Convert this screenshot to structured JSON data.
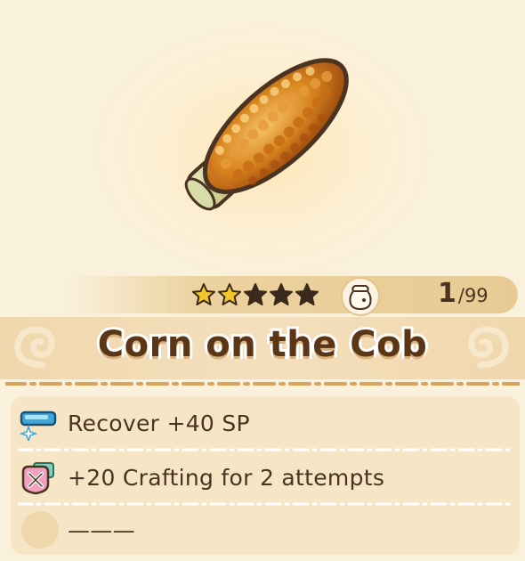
{
  "item": {
    "name": "Corn on the Cob",
    "icon": "corn-cob-icon",
    "rating_filled": 2,
    "rating_total": 5,
    "quantity": "1",
    "quantity_max": "/99"
  },
  "effects": [
    {
      "icon": "sp-bar-icon",
      "text": "Recover +40 SP"
    },
    {
      "icon": "crafting-tools-icon",
      "text": "+20 Crafting for 2 attempts"
    },
    {
      "icon": "empty-slot",
      "text": "———"
    }
  ],
  "colors": {
    "background": "#faf1dc",
    "star_filled": "#f2c62a",
    "star_empty": "#3b2a1c",
    "text": "#4a3320",
    "title_text": "#5a3616",
    "panel": "#f6e6c6",
    "accent_dash": "#d9a35e"
  }
}
